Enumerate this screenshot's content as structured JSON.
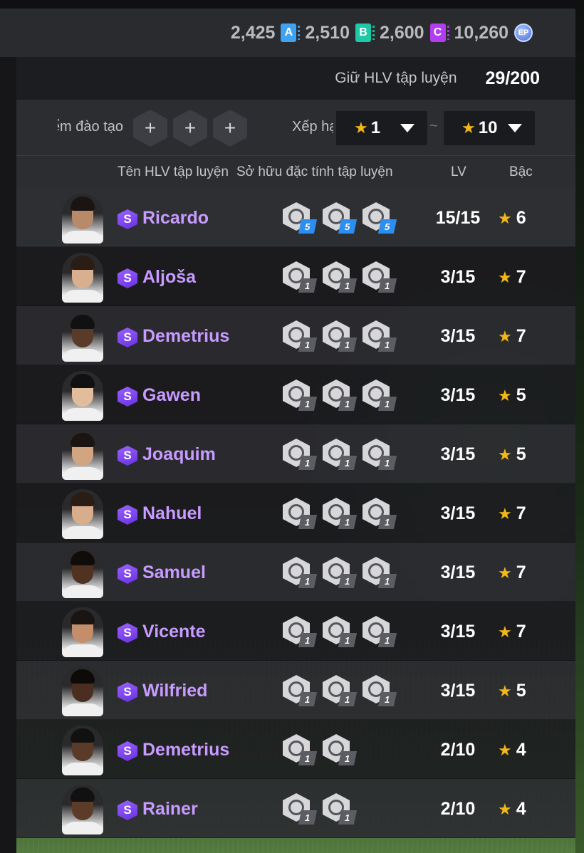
{
  "currencies": [
    {
      "id": "a",
      "value": "2,425",
      "icon": "A",
      "color": "#3fa3f2"
    },
    {
      "id": "b",
      "value": "2,510",
      "icon": "B",
      "color": "#1ec9a8"
    },
    {
      "id": "c",
      "value": "2,600",
      "icon": "C",
      "color": "#b33df2"
    },
    {
      "id": "ep",
      "value": "10,260",
      "icon": "EP",
      "color": "#4a6fdc"
    }
  ],
  "holder": {
    "label": "Giữ HLV tập luyện",
    "value": "29/200"
  },
  "filters": {
    "training_label": "ểm đào tạo",
    "plus": "+",
    "rank_label": "Xếp hạ",
    "min_rank": "1",
    "max_rank": "10",
    "star": "★",
    "tilde": "~"
  },
  "columns": {
    "name": "Tên HLV tập luyện",
    "traits": "Sở hữu đặc tính tập luyện",
    "lv": "LV",
    "grade": "Bậc"
  },
  "coaches": [
    {
      "rank_icon": "S",
      "name": "Ricardo",
      "traits": [
        "5",
        "5",
        "5"
      ],
      "max": true,
      "lv": "15/15",
      "grade": "6",
      "skin": "#b98a6a",
      "hair": "#1a1512"
    },
    {
      "rank_icon": "S",
      "name": "Aljoša",
      "traits": [
        "1",
        "1",
        "1"
      ],
      "max": false,
      "lv": "3/15",
      "grade": "7",
      "skin": "#d9b08f",
      "hair": "#2a1d15"
    },
    {
      "rank_icon": "S",
      "name": "Demetrius",
      "traits": [
        "1",
        "1",
        "1"
      ],
      "max": false,
      "lv": "3/15",
      "grade": "7",
      "skin": "#5a3a28",
      "hair": "#111"
    },
    {
      "rank_icon": "S",
      "name": "Gawen",
      "traits": [
        "1",
        "1",
        "1"
      ],
      "max": false,
      "lv": "3/15",
      "grade": "5",
      "skin": "#e2bd9b",
      "hair": "#111"
    },
    {
      "rank_icon": "S",
      "name": "Joaquim",
      "traits": [
        "1",
        "1",
        "1"
      ],
      "max": false,
      "lv": "3/15",
      "grade": "5",
      "skin": "#d2a582",
      "hair": "#1b1410"
    },
    {
      "rank_icon": "S",
      "name": "Nahuel",
      "traits": [
        "1",
        "1",
        "1"
      ],
      "max": false,
      "lv": "3/15",
      "grade": "7",
      "skin": "#d8ad8c",
      "hair": "#2a1d15"
    },
    {
      "rank_icon": "S",
      "name": "Samuel",
      "traits": [
        "1",
        "1",
        "1"
      ],
      "max": false,
      "lv": "3/15",
      "grade": "7",
      "skin": "#4f3222",
      "hair": "#0f0c0a"
    },
    {
      "rank_icon": "S",
      "name": "Vicente",
      "traits": [
        "1",
        "1",
        "1"
      ],
      "max": false,
      "lv": "3/15",
      "grade": "7",
      "skin": "#c38e69",
      "hair": "#1a1512"
    },
    {
      "rank_icon": "S",
      "name": "Wilfried",
      "traits": [
        "1",
        "1",
        "1"
      ],
      "max": false,
      "lv": "3/15",
      "grade": "5",
      "skin": "#4a2f20",
      "hair": "#0d0a08"
    },
    {
      "rank_icon": "S",
      "name": "Demetrius",
      "traits": [
        "1",
        "1"
      ],
      "max": false,
      "lv": "2/10",
      "grade": "4",
      "skin": "#5a3a28",
      "hair": "#111"
    },
    {
      "rank_icon": "S",
      "name": "Rainer",
      "traits": [
        "1",
        "1"
      ],
      "max": false,
      "lv": "2/10",
      "grade": "4",
      "skin": "#5c3b28",
      "hair": "#111"
    }
  ]
}
